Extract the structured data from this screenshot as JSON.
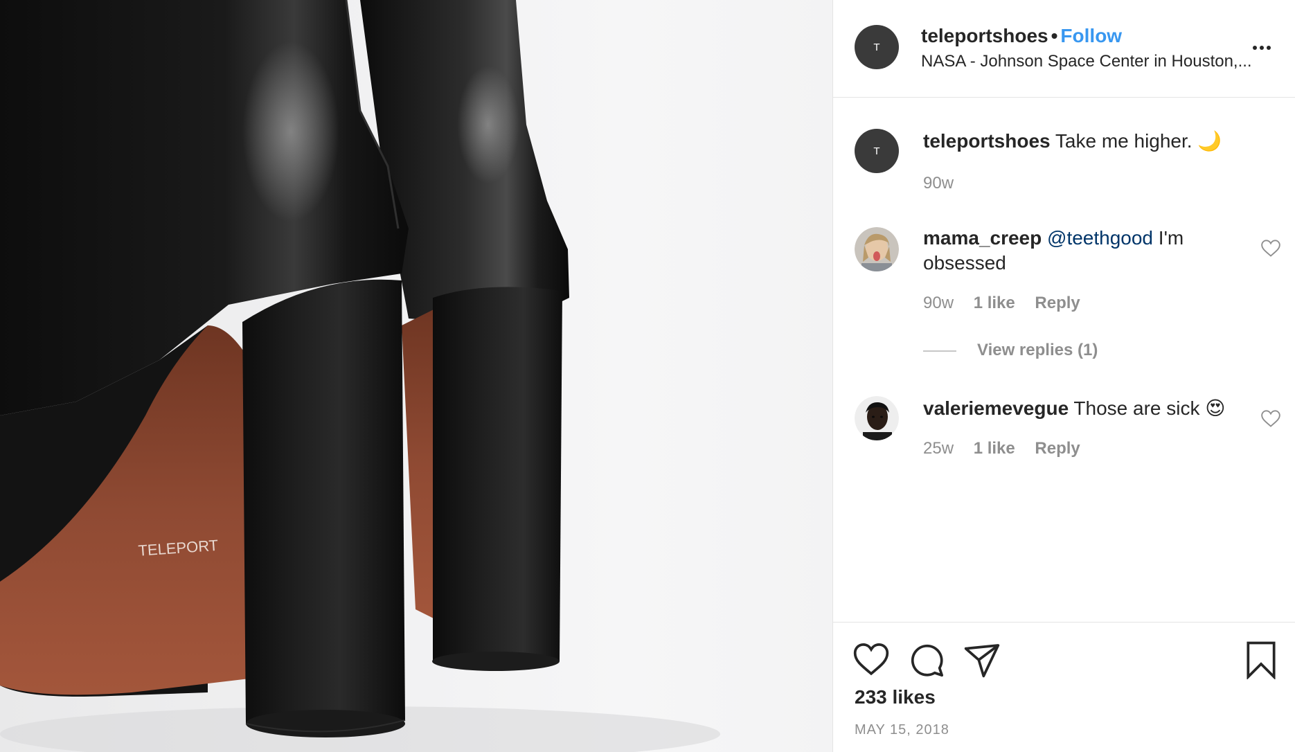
{
  "photo": {
    "alt": "Black leather platform block-heel ankle boots",
    "sole_brand": "TELEPORT",
    "colors": {
      "leather": "#111111",
      "sole": "#8a4530",
      "background": "#efeff0"
    }
  },
  "post": {
    "author": {
      "avatar_initial": "T",
      "username": "teleportshoes",
      "separator": "•",
      "follow_label": "Follow",
      "location": "NASA - Johnson Space Center in Houston,..."
    },
    "more_icon": "more-horizontal-icon",
    "caption": {
      "avatar_initial": "T",
      "username": "teleportshoes",
      "text": "Take me higher.",
      "emoji": "🌙",
      "time": "90w"
    },
    "comments": [
      {
        "username": "mama_creep",
        "mention": "@teethgood",
        "text": "I'm obsessed",
        "time": "90w",
        "likes": "1 like",
        "reply_label": "Reply",
        "view_replies": "View replies (1)"
      },
      {
        "username": "valeriemevegue",
        "text": "Those are sick",
        "emoji": "😍",
        "time": "25w",
        "likes": "1 like",
        "reply_label": "Reply"
      }
    ],
    "actions": [
      "heart-icon",
      "comment-icon",
      "share-icon",
      "bookmark-icon"
    ],
    "likes_count": "233 likes",
    "date": "MAY 15, 2018"
  },
  "colors": {
    "link": "#3897f0",
    "mention": "#003569",
    "muted": "#8e8e8e",
    "text": "#262626",
    "border": "#e4e4e4"
  }
}
